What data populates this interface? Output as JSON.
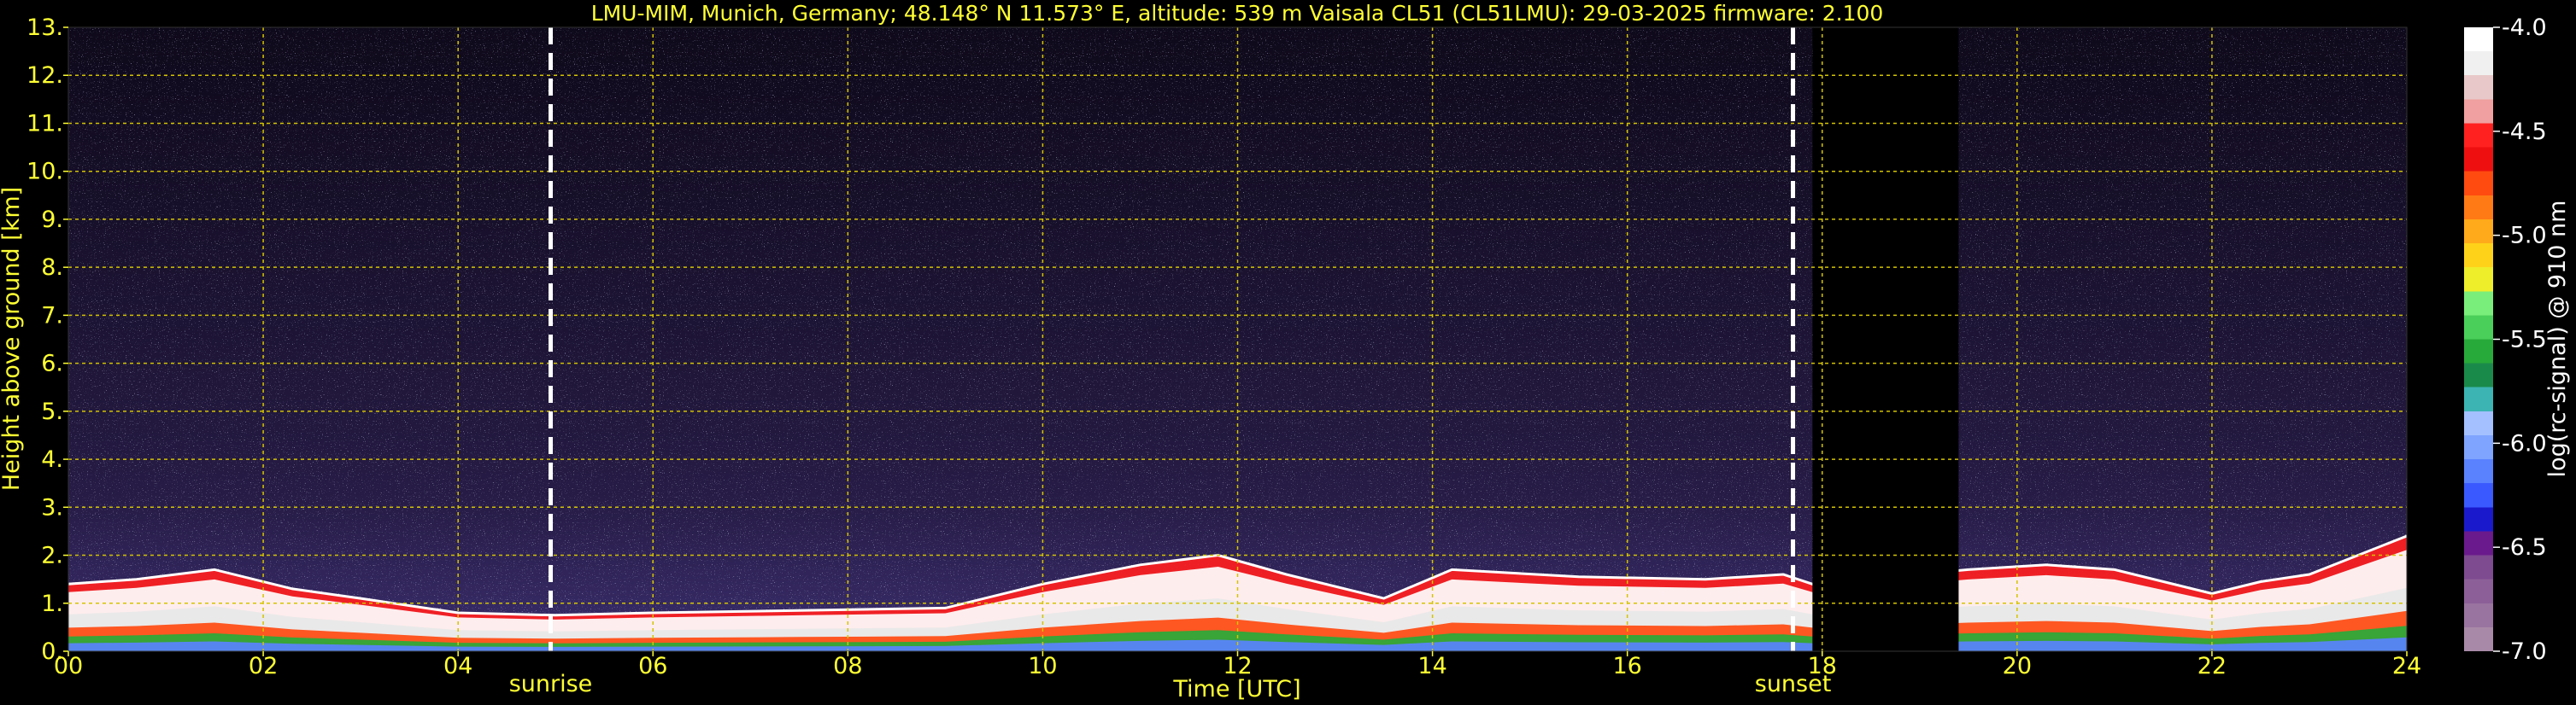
{
  "chart_data": {
    "type": "heatmap",
    "title": "LMU-MIM, Munich, Germany; 48.148° N 11.573° E, altitude: 539 m    Vaisala CL51 (CL51LMU): 29-03-2025    firmware: 2.100",
    "xlabel": "Time [UTC]",
    "ylabel": "Height above ground [km]",
    "xlim": [
      0,
      24
    ],
    "ylim": [
      0,
      13
    ],
    "x_ticks": [
      "00",
      "02",
      "04",
      "06",
      "08",
      "10",
      "12",
      "14",
      "16",
      "18",
      "20",
      "22",
      "24"
    ],
    "y_ticks": [
      "0.",
      "1.",
      "2.",
      "3.",
      "4.",
      "5.",
      "6.",
      "7.",
      "8.",
      "9.",
      "10.",
      "11.",
      "12.",
      "13."
    ],
    "grid": true,
    "colorbar": {
      "label": "log(rc-signal) @ 910 nm",
      "range": [
        -7.0,
        -4.0
      ],
      "ticks": [
        "-4.0",
        "-4.5",
        "-5.0",
        "-5.5",
        "-6.0",
        "-6.5",
        "-7.0"
      ],
      "colors": [
        "#a88aa8",
        "#9a74a0",
        "#8c5f98",
        "#7e4a90",
        "#6a1a8c",
        "#1a1acc",
        "#3a5aff",
        "#5a82ff",
        "#7ea4ff",
        "#a4c0ff",
        "#3cb4b4",
        "#1a8a4a",
        "#28aa3a",
        "#4ad05a",
        "#7aee7a",
        "#eeee2a",
        "#ffd21a",
        "#ffaa1a",
        "#ff7a14",
        "#ff4a10",
        "#ee1010",
        "#ff2020",
        "#f0a0a0",
        "#e8c8c8",
        "#f0f0f0",
        "#ffffff"
      ]
    },
    "annotations": [
      {
        "label": "sunrise",
        "x": 4.95
      },
      {
        "label": "sunset",
        "x": 17.7
      }
    ],
    "data_gaps": [
      [
        17.9,
        19.4
      ]
    ],
    "boundary_layer_top_km": {
      "x": [
        0,
        0.7,
        1.5,
        2.3,
        3.0,
        4.0,
        5.0,
        6.0,
        7.5,
        9.0,
        10.0,
        11.0,
        11.8,
        12.5,
        13.5,
        14.2,
        15.5,
        16.8,
        17.6,
        17.9,
        19.5,
        20.3,
        21.0,
        22.0,
        22.5,
        23.0,
        24.0
      ],
      "y": [
        1.4,
        1.5,
        1.7,
        1.3,
        1.1,
        0.8,
        0.75,
        0.8,
        0.85,
        0.9,
        1.4,
        1.8,
        2.0,
        1.6,
        1.1,
        1.7,
        1.55,
        1.5,
        1.6,
        1.4,
        1.7,
        1.8,
        1.7,
        1.2,
        1.45,
        1.6,
        2.4
      ]
    }
  }
}
